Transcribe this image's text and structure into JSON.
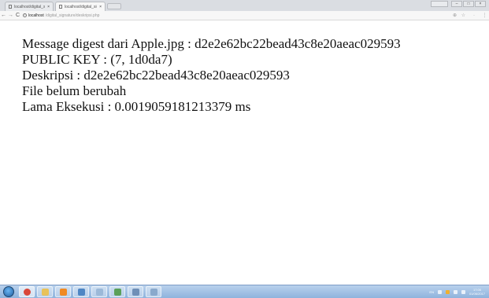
{
  "browser": {
    "tabs": [
      {
        "title": "localhost/digital_signat",
        "close": "×"
      },
      {
        "title": "localhost/digital_signat",
        "close": "×"
      }
    ],
    "url_host": "localhost",
    "url_path": "/digital_signature/deskripsi.php",
    "info_glyph": "i",
    "back_glyph": "←",
    "forward_glyph": "→",
    "reload_glyph": "C",
    "zoom_glyph": "⊕",
    "star_glyph": "☆",
    "menu_glyph": "⋮",
    "min_glyph": "–",
    "max_glyph": "□",
    "close_glyph": "×"
  },
  "page": {
    "lines": [
      "Message digest dari Apple.jpg : d2e2e62bc22bead43c8e20aeac029593",
      "PUBLIC KEY : (7, 1d0da7)",
      "Deskripsi : d2e2e62bc22bead43c8e20aeac029593",
      "File belum berubah",
      "Lama Eksekusi : 0.0019059181213379 ms"
    ]
  },
  "taskbar": {
    "items": [
      {
        "icon": "chrome-icon",
        "color": "#d9463a",
        "active": true
      },
      {
        "icon": "folder-icon",
        "color": "#e8c25a",
        "active": false
      },
      {
        "icon": "app-icon",
        "color": "#f08a24",
        "active": false
      },
      {
        "icon": "media-icon",
        "color": "#4e86c4",
        "active": false
      },
      {
        "icon": "network-icon",
        "color": "#9cb9d8",
        "active": false
      },
      {
        "icon": "paint-icon",
        "color": "#5aa05a",
        "active": false
      },
      {
        "icon": "calculator-icon",
        "color": "#6f8fb7",
        "active": false
      },
      {
        "icon": "window-icon",
        "color": "#8aa9cc",
        "active": false
      }
    ],
    "tray_lang": "EN",
    "clock_time": "17:00",
    "clock_date": "01/06/2017"
  }
}
